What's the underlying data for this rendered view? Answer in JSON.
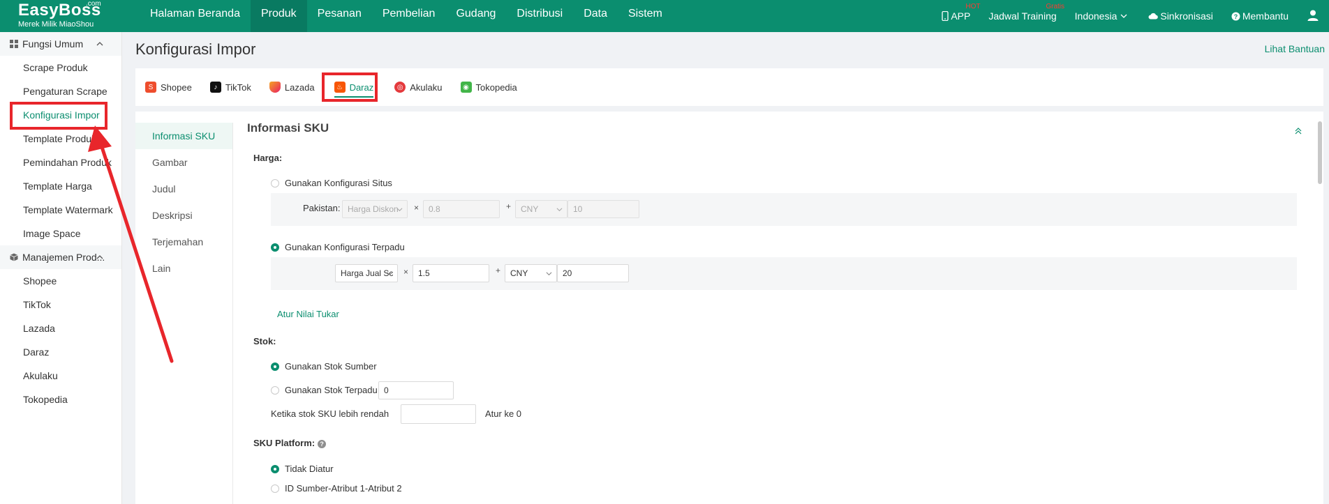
{
  "brand": {
    "name": "EasyBoss",
    "com": ".com",
    "tagline": "Merek Milik MiaoShou"
  },
  "nav": {
    "items": [
      {
        "label": "Halaman Beranda"
      },
      {
        "label": "Produk"
      },
      {
        "label": "Pesanan"
      },
      {
        "label": "Pembelian"
      },
      {
        "label": "Gudang"
      },
      {
        "label": "Distribusi"
      },
      {
        "label": "Data"
      },
      {
        "label": "Sistem"
      }
    ]
  },
  "top_right": {
    "app_label": "APP",
    "app_sup": "HOT",
    "training_label": "Jadwal Training",
    "training_sup": "Gratis",
    "language": "Indonesia",
    "sync_label": "Sinkronisasi",
    "help_label": "Membantu"
  },
  "sidebar": {
    "group1": "Fungsi Umum",
    "group1_items": [
      {
        "label": "Scrape Produk"
      },
      {
        "label": "Pengaturan Scrape"
      },
      {
        "label": "Konfigurasi Impor"
      },
      {
        "label": "Template Produk"
      },
      {
        "label": "Pemindahan Produk"
      },
      {
        "label": "Template Harga"
      },
      {
        "label": "Template Watermark"
      },
      {
        "label": "Image Space"
      }
    ],
    "group2": "Manajemen Prod...",
    "group2_items": [
      {
        "label": "Shopee"
      },
      {
        "label": "TikTok"
      },
      {
        "label": "Lazada"
      },
      {
        "label": "Daraz"
      },
      {
        "label": "Akulaku"
      },
      {
        "label": "Tokopedia"
      }
    ]
  },
  "page": {
    "title": "Konfigurasi Impor",
    "help_link": "Lihat Bantuan"
  },
  "platform_tabs": [
    {
      "label": "Shopee",
      "color": "#ee4d2d"
    },
    {
      "label": "TikTok",
      "color": "#111111"
    },
    {
      "label": "Lazada",
      "color": "#f36f21"
    },
    {
      "label": "Daraz",
      "color": "#f85606"
    },
    {
      "label": "Akulaku",
      "color": "#e4393c"
    },
    {
      "label": "Tokopedia",
      "color": "#42b549"
    }
  ],
  "subnav": [
    {
      "label": "Informasi SKU"
    },
    {
      "label": "Gambar"
    },
    {
      "label": "Judul"
    },
    {
      "label": "Deskripsi"
    },
    {
      "label": "Terjemahan"
    },
    {
      "label": "Lain"
    }
  ],
  "sku": {
    "section_title": "Informasi SKU",
    "price_label": "Harga:",
    "opt_site": "Gunakan Konfigurasi Situs",
    "site_country": "Pakistan:",
    "site_price_type": "Harga Diskon",
    "site_multiplier": "0.8",
    "site_currency": "CNY",
    "site_add": "10",
    "opt_unified": "Gunakan Konfigurasi Terpadu",
    "unified_price_type": "Harga Jual Sc",
    "unified_multiplier": "1.5",
    "unified_currency": "CNY",
    "unified_add": "20",
    "times": "×",
    "plus": "+",
    "exchange_link": "Atur Nilai Tukar",
    "stock_label": "Stok:",
    "opt_source_stock": "Gunakan Stok Sumber",
    "opt_unified_stock": "Gunakan Stok Terpadu",
    "unified_stock_value": "0",
    "low_stock_text": "Ketika stok SKU lebih rendah",
    "low_stock_value": "",
    "set_to_zero": "Atur ke 0",
    "platform_sku_label": "SKU Platform:",
    "opt_not_set": "Tidak Diatur",
    "opt_source_id": "ID Sumber-Atribut 1-Atribut 2"
  },
  "colors": {
    "primary": "#0b8e6f",
    "highlight": "#e8262b"
  }
}
